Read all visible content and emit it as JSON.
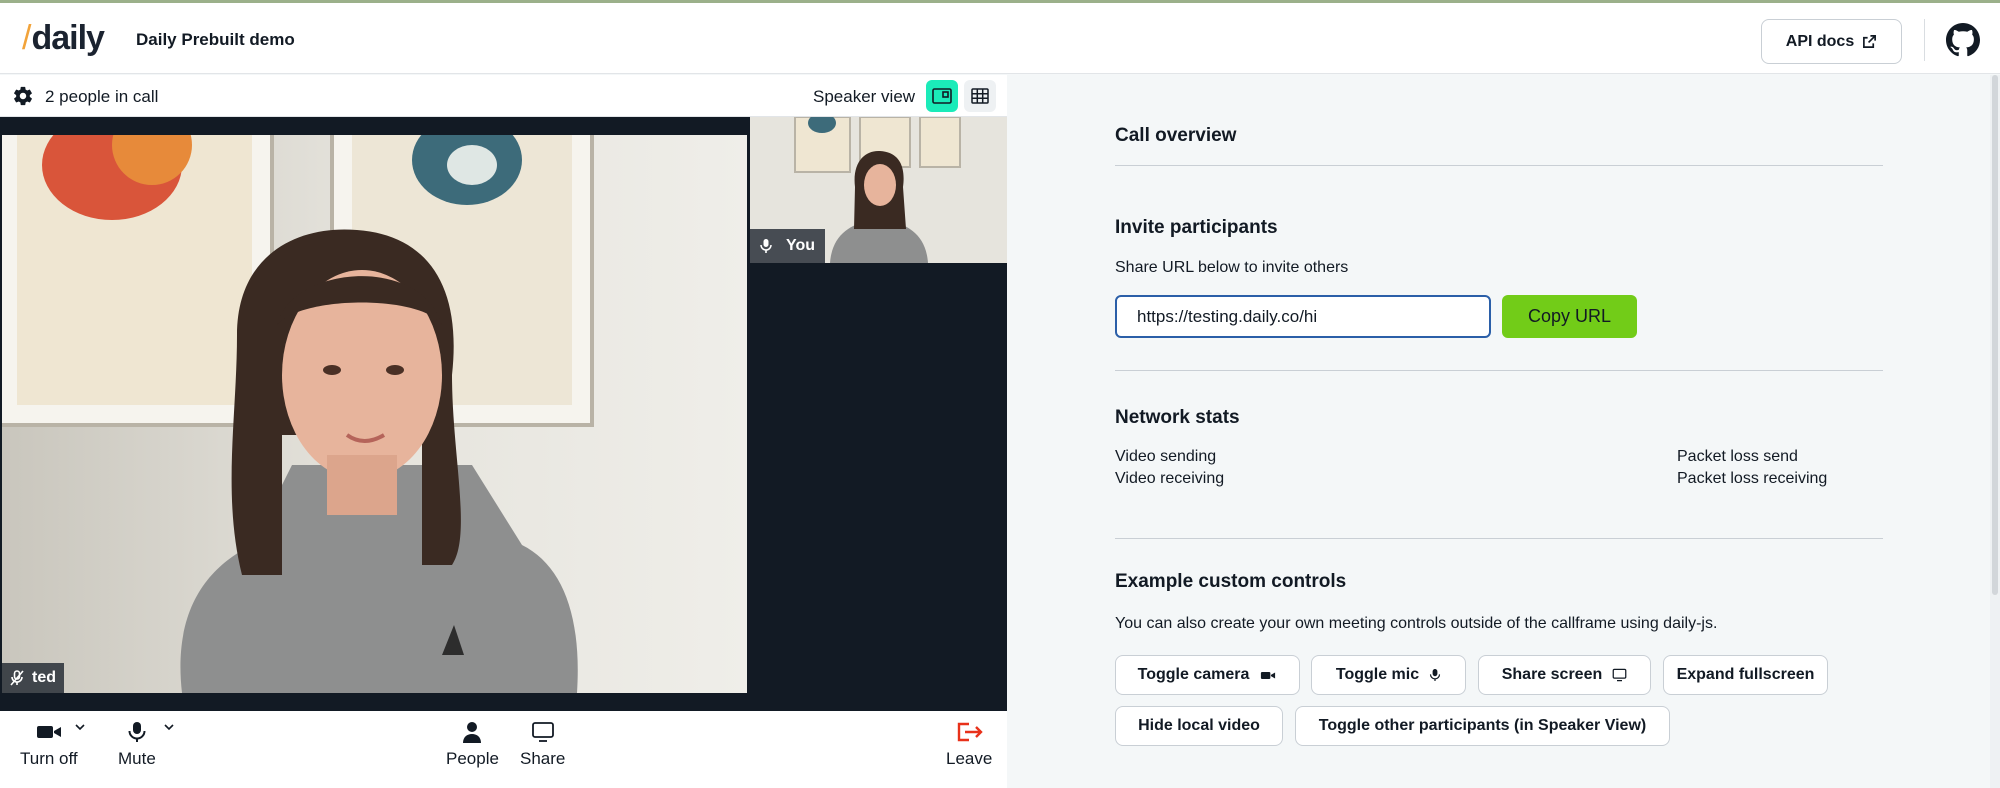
{
  "header": {
    "logo_text": "daily",
    "title": "Daily Prebuilt demo",
    "api_docs_label": "API docs"
  },
  "call": {
    "people_count": "2 people in call",
    "view_label": "Speaker view",
    "active_view": "speaker",
    "main_participant": "ted",
    "local_participant": "You",
    "tray": {
      "camera": "Turn off",
      "mic": "Mute",
      "people": "People",
      "share": "Share",
      "leave": "Leave"
    }
  },
  "panel": {
    "call_overview": "Call overview",
    "invite": {
      "title": "Invite participants",
      "description": "Share URL below to invite others",
      "url": "https://testing.daily.co/hi",
      "copy_label": "Copy URL"
    },
    "network": {
      "title": "Network stats",
      "video_sending": "Video sending",
      "video_receiving": "Video receiving",
      "packet_loss_send": "Packet loss send",
      "packet_loss_receiving": "Packet loss receiving"
    },
    "controls": {
      "title": "Example custom controls",
      "description": "You can also create your own meeting controls outside of the callframe using daily-js.",
      "toggle_camera": "Toggle camera",
      "toggle_mic": "Toggle mic",
      "share_screen": "Share screen",
      "expand_fullscreen": "Expand fullscreen",
      "hide_local_video": "Hide local video",
      "toggle_other": "Toggle other participants (in Speaker View)"
    }
  },
  "colors": {
    "accent_teal": "#1bebb9",
    "copy_green": "#72cc18",
    "leave_red": "#e8311a",
    "logo_orange": "#f2a33a"
  }
}
